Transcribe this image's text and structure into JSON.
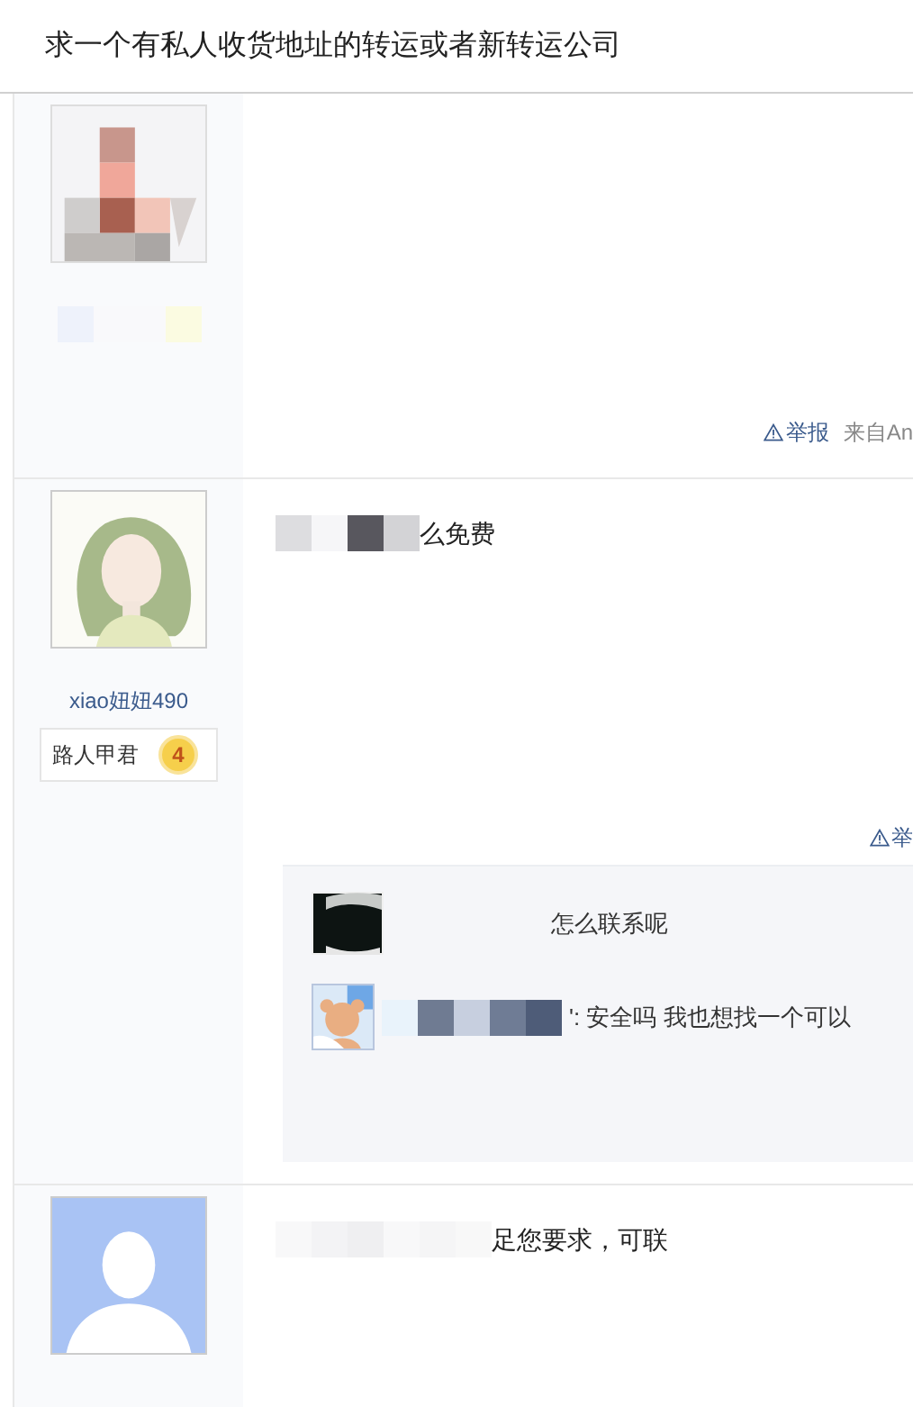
{
  "thread_title": "求一个有私人收货地址的转运或者新转运公司",
  "posts": [
    {
      "kind": "hidden_author",
      "report_link": "举报",
      "source": "来自An"
    },
    {
      "kind": "member",
      "username": "xiao妞妞490",
      "rank": "路人甲君",
      "level_badge": "4",
      "content": "么免费",
      "report_link": "举",
      "comments": [
        {
          "kind": "dark_avatar",
          "text": "怎么联系呢"
        },
        {
          "kind": "bear_avatar",
          "text": "': 安全吗 我也想找一个可以"
        }
      ]
    },
    {
      "kind": "guest",
      "content": "足您要求，可联"
    }
  ]
}
